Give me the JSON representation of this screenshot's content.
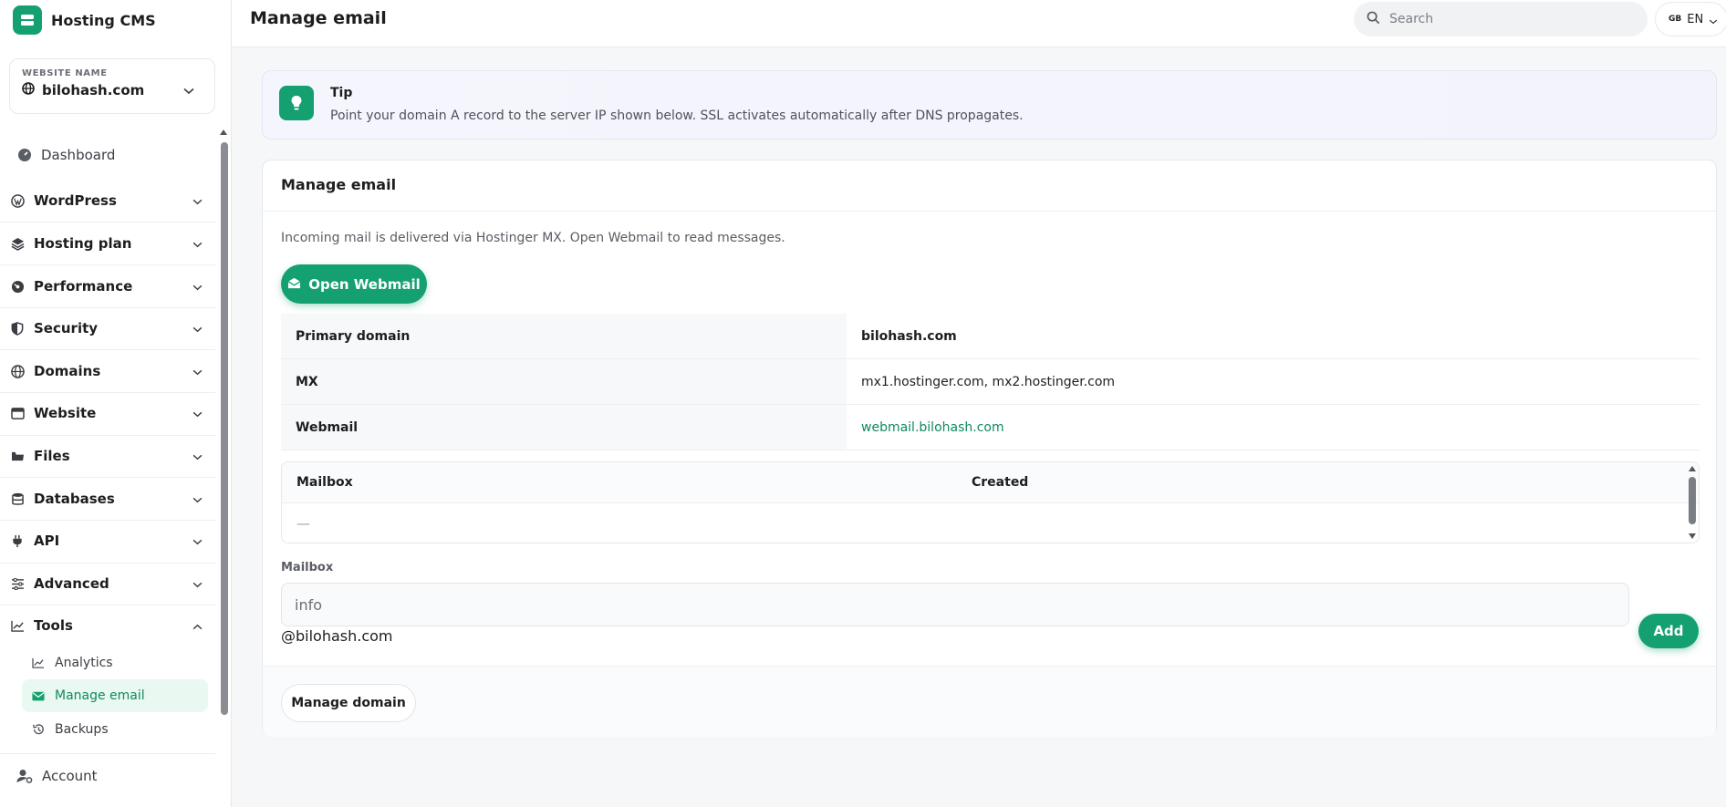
{
  "app": {
    "name": "Hosting CMS"
  },
  "website": {
    "label": "WEBSITE NAME",
    "name": "bilohash.com"
  },
  "sidebar": {
    "items": [
      {
        "label": "Dashboard",
        "icon": "dashboard-icon"
      },
      {
        "label": "WordPress",
        "icon": "wordpress-icon"
      },
      {
        "label": "Hosting plan",
        "icon": "layers-icon"
      },
      {
        "label": "Performance",
        "icon": "gauge-icon"
      },
      {
        "label": "Security",
        "icon": "shield-icon"
      },
      {
        "label": "Domains",
        "icon": "globe-icon"
      },
      {
        "label": "Website",
        "icon": "window-icon"
      },
      {
        "label": "Files",
        "icon": "folder-icon"
      },
      {
        "label": "Databases",
        "icon": "database-icon"
      },
      {
        "label": "API",
        "icon": "plug-icon"
      },
      {
        "label": "Advanced",
        "icon": "sliders-icon"
      },
      {
        "label": "Tools",
        "icon": "chart-line-icon"
      }
    ],
    "tools_sub": [
      {
        "label": "Analytics",
        "icon": "chart-line-icon"
      },
      {
        "label": "Manage email",
        "icon": "envelope-icon",
        "active": true
      },
      {
        "label": "Backups",
        "icon": "history-icon"
      }
    ],
    "account": "Account"
  },
  "header": {
    "title": "Manage email",
    "search_placeholder": "Search",
    "lang_flag": "GB",
    "lang_code": "EN"
  },
  "tip": {
    "title": "Tip",
    "text": "Point your domain A record to the server IP shown below. SSL activates automatically after DNS propagates."
  },
  "card": {
    "title": "Manage email",
    "description": "Incoming mail is delivered via Hostinger MX. Open Webmail to read messages.",
    "open_webmail": "Open Webmail",
    "info": [
      {
        "key": "Primary domain",
        "value": "bilohash.com"
      },
      {
        "key": "MX",
        "value": "mx1.hostinger.com, mx2.hostinger.com"
      },
      {
        "key": "Webmail",
        "value": "webmail.bilohash.com"
      }
    ],
    "mailboxes": {
      "headers": [
        "Mailbox",
        "Created"
      ],
      "empty": "—"
    },
    "form": {
      "label": "Mailbox",
      "placeholder": "info",
      "suffix": "@bilohash.com",
      "add": "Add"
    },
    "manage_domain": "Manage domain"
  },
  "colors": {
    "accent": "#14a071",
    "link": "#0f8a5f"
  }
}
